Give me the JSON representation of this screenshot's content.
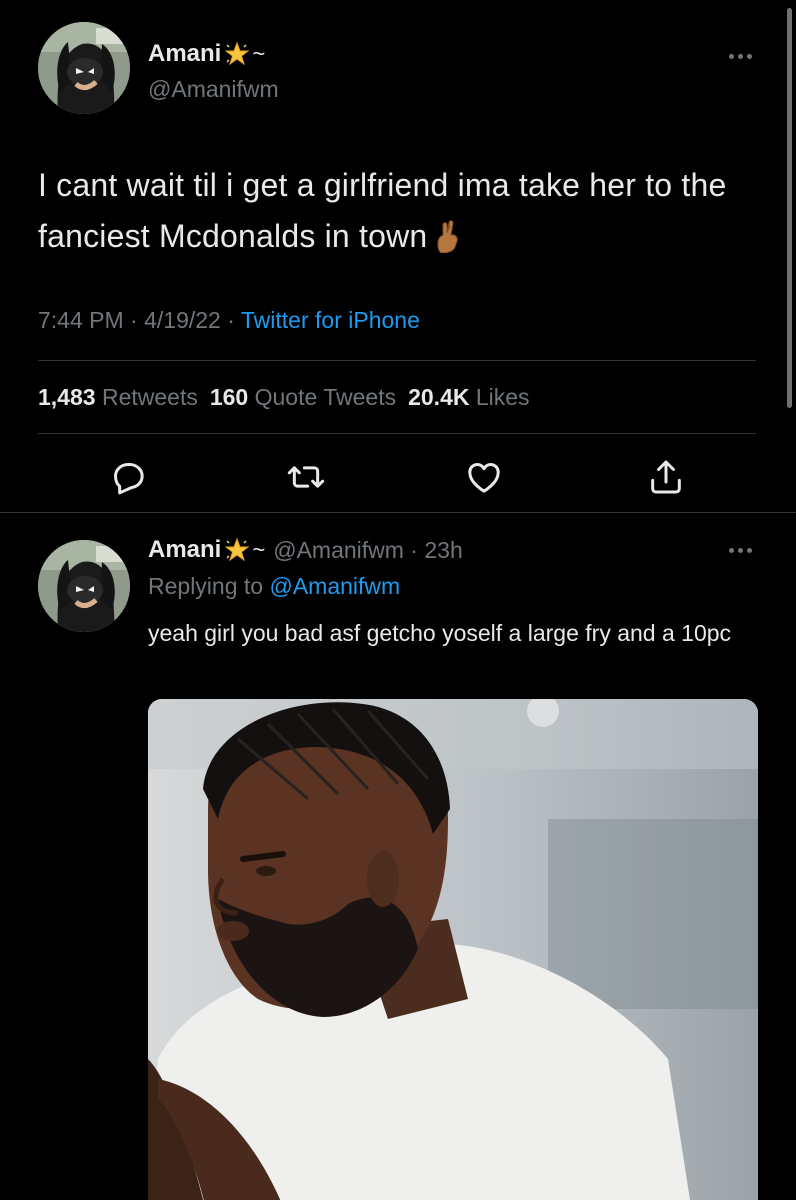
{
  "colors": {
    "background": "#000000",
    "primary_text": "#e7e9ea",
    "secondary_text": "#71767b",
    "accent": "#1d9bf0",
    "divider": "#2f3336"
  },
  "main_tweet": {
    "display_name": "Amani",
    "name_suffix": "~",
    "name_emoji_icon": "sparkle-star-icon",
    "handle": "@Amanifwm",
    "text": "I cant wait til i get a girlfriend ima take her to the fanciest Mcdonalds in town",
    "text_emoji_icon": "crossed-fingers-icon",
    "time": "7:44 PM",
    "date": "4/19/22",
    "source": "Twitter for iPhone",
    "stats": {
      "retweets_count": "1,483",
      "retweets_label": "Retweets",
      "quotes_count": "160",
      "quotes_label": "Quote Tweets",
      "likes_count": "20.4K",
      "likes_label": "Likes"
    },
    "actions": [
      "reply-icon",
      "retweet-icon",
      "like-icon",
      "share-icon"
    ]
  },
  "reply_tweet": {
    "display_name": "Amani",
    "name_suffix": "~",
    "handle": "@Amanifwm",
    "time_ago": "23h",
    "replying_label": "Replying to",
    "replying_to": "@Amanifwm",
    "text": "yeah girl you bad asf getcho yoself a large fry and a 10pc",
    "media_icon": "gif-photo"
  }
}
